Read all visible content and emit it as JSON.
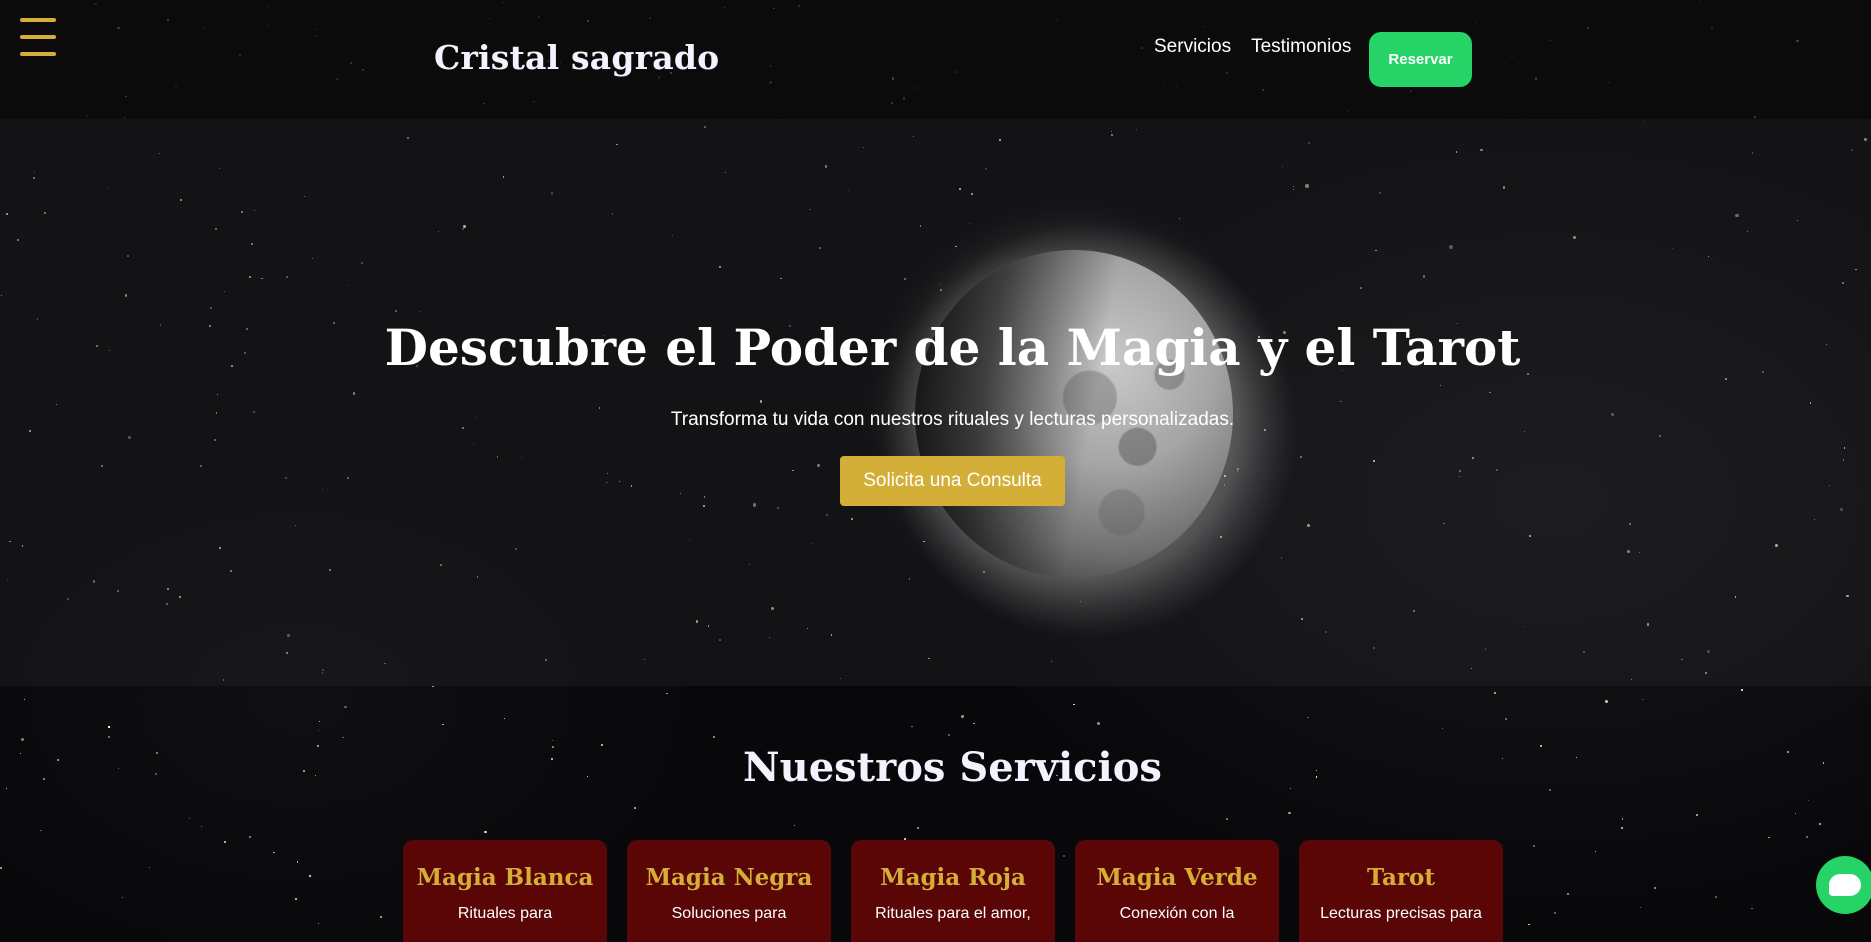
{
  "header": {
    "brand": "Cristal sagrado",
    "nav": [
      {
        "label": "Servicios"
      },
      {
        "label": "Testimonios"
      }
    ],
    "reserve_label": "Reservar"
  },
  "hero": {
    "title": "Descubre el Poder de la Magia y el Tarot",
    "subtitle": "Transforma tu vida con nuestros rituales y lecturas personalizadas.",
    "cta_label": "Solicita una Consulta"
  },
  "services": {
    "title": "Nuestros Servicios",
    "cards": [
      {
        "title": "Magia Blanca",
        "text": "Rituales para"
      },
      {
        "title": "Magia Negra",
        "text": "Soluciones para"
      },
      {
        "title": "Magia Roja",
        "text": "Rituales para el amor,"
      },
      {
        "title": "Magia Verde",
        "text": "Conexión con la"
      },
      {
        "title": "Tarot",
        "text": "Lecturas precisas para"
      }
    ]
  },
  "colors": {
    "accent_gold": "#d4af37",
    "whatsapp_green": "#25d366",
    "card_red": "#5a0606"
  },
  "icons": {
    "menu": "hamburger-icon",
    "chat": "chat-bubble-icon"
  }
}
